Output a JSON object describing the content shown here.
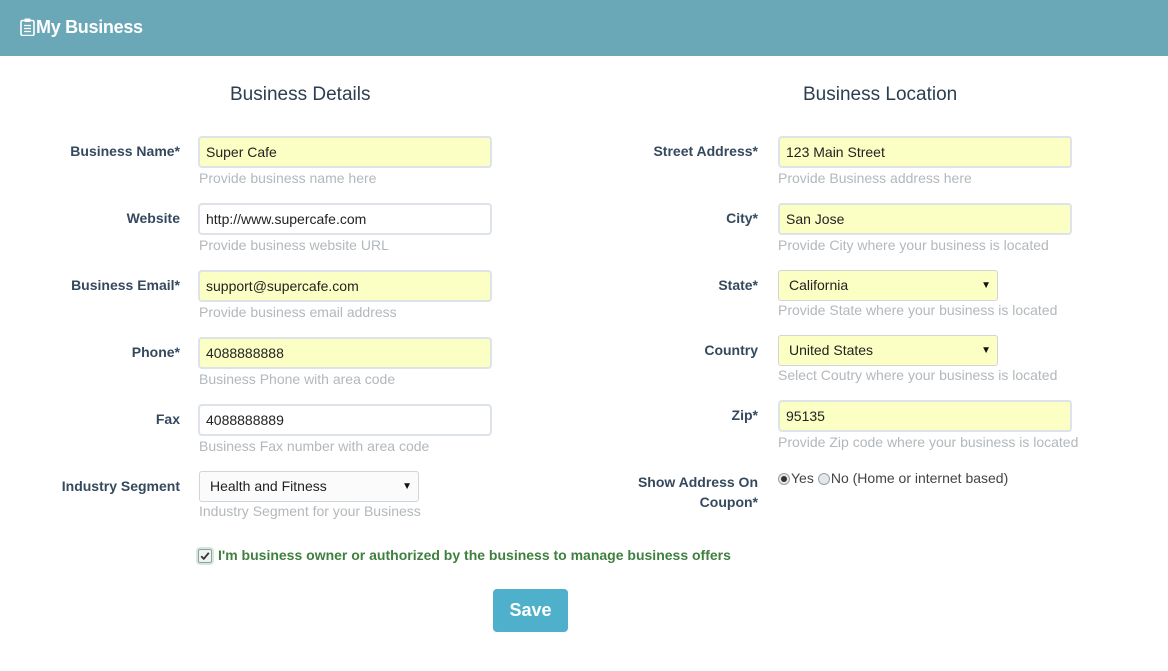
{
  "header": {
    "title": "My Business",
    "icon": "clipboard-icon",
    "background": "#6aa7b7"
  },
  "details": {
    "title": "Business Details",
    "business_name": {
      "label": "Business Name*",
      "value": "Super Cafe",
      "help": "Provide business name here"
    },
    "website": {
      "label": "Website",
      "value": "http://www.supercafe.com",
      "help": "Provide business website URL"
    },
    "business_email": {
      "label": "Business Email*",
      "value": "support@supercafe.com",
      "help": "Provide business email address"
    },
    "phone": {
      "label": "Phone*",
      "value": "4088888888",
      "help": "Business Phone with area code"
    },
    "fax": {
      "label": "Fax",
      "value": "4088888889",
      "help": "Business Fax number with area code"
    },
    "industry_segment": {
      "label": "Industry Segment",
      "value": "Health and Fitness",
      "help": "Industry Segment for your Business"
    }
  },
  "location": {
    "title": "Business Location",
    "street_address": {
      "label": "Street Address*",
      "value": "123 Main Street",
      "help": "Provide Business address here"
    },
    "city": {
      "label": "City*",
      "value": "San Jose",
      "help": "Provide City where your business is located"
    },
    "state": {
      "label": "State*",
      "value": "California",
      "help": "Provide State where your business is located"
    },
    "country": {
      "label": "Country",
      "value": "United States",
      "help": "Select Coutry where your business is located"
    },
    "zip": {
      "label": "Zip*",
      "value": "95135",
      "help": "Provide Zip code where your business is located"
    },
    "show_address": {
      "label": "Show Address On Coupon*",
      "option_yes": "Yes",
      "option_no": "No (Home or internet based)",
      "selected": "Yes"
    }
  },
  "consent": {
    "label": "I'm business owner or authorized by the business to manage business offers",
    "checked": true
  },
  "actions": {
    "save_label": "Save"
  },
  "colors": {
    "filled_field": "#fcffc4",
    "primary_button": "#4fb0cc",
    "consent_text": "#3f7f3f"
  }
}
